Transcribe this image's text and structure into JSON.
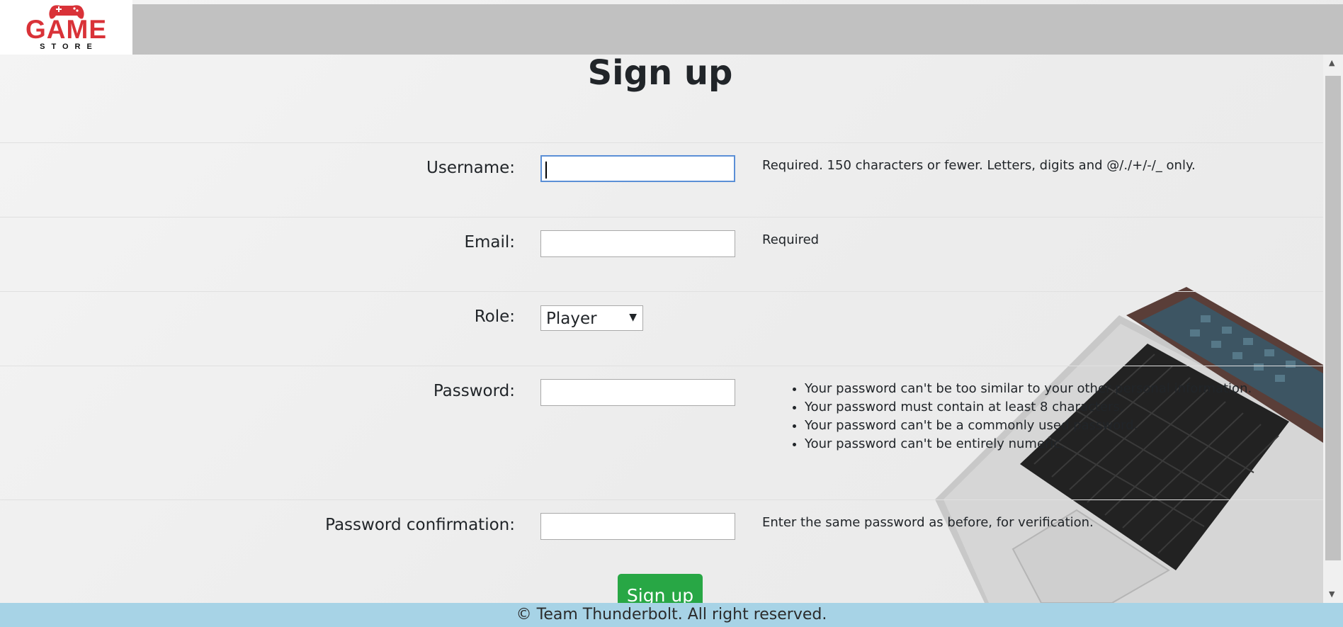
{
  "header": {
    "logo": {
      "title": "GAME",
      "subtitle": "STORE"
    }
  },
  "page_title": "Sign up",
  "form": {
    "username": {
      "label": "Username:",
      "value": "",
      "help": "Required. 150 characters or fewer. Letters, digits and @/./+/-/_ only."
    },
    "email": {
      "label": "Email:",
      "value": "",
      "help": "Required"
    },
    "role": {
      "label": "Role:",
      "selected": "Player"
    },
    "password": {
      "label": "Password:",
      "value": "",
      "help_items": [
        "Your password can't be too similar to your other personal information.",
        "Your password must contain at least 8 characters.",
        "Your password can't be a commonly used password.",
        "Your password can't be entirely numeric."
      ]
    },
    "password_confirmation": {
      "label": "Password confirmation:",
      "value": "",
      "help": "Enter the same password as before, for verification."
    },
    "submit_label": "Sign up"
  },
  "footer": {
    "text": "© Team Thunderbolt. All right reserved."
  },
  "colors": {
    "brand_red": "#d93238",
    "header_bar": "#c1c1c1",
    "submit_green": "#28a745",
    "footer_blue": "#a7d3e6"
  }
}
